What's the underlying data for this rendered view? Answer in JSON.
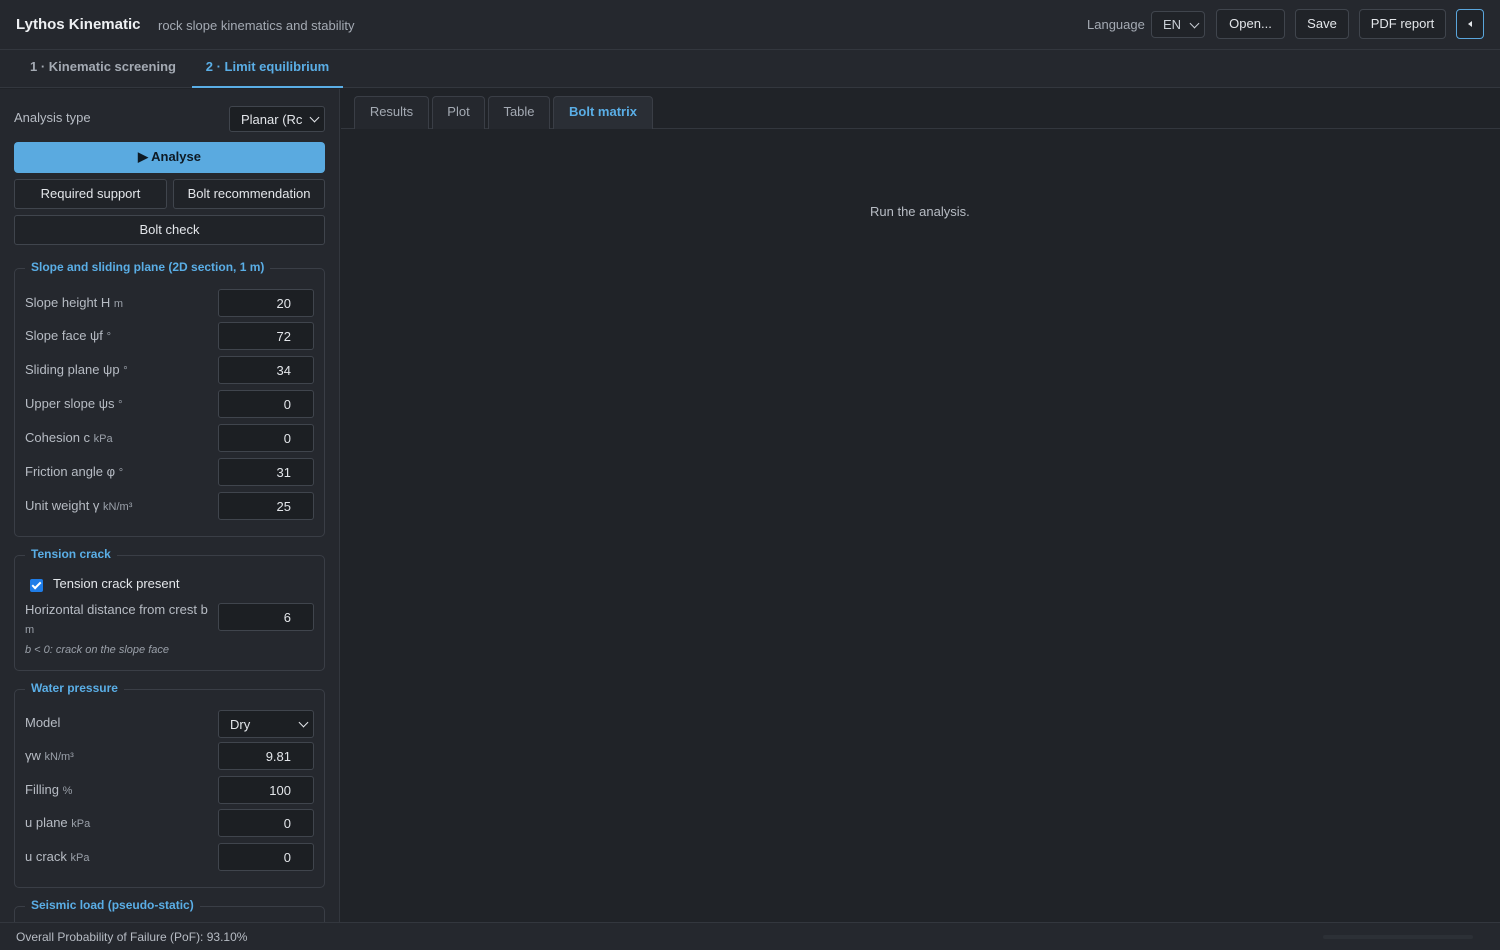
{
  "header": {
    "title": "Lythos Kinematic",
    "subtitle": "rock slope kinematics and stability",
    "language_label": "Language",
    "language_value": "EN",
    "open_label": "Open...",
    "save_label": "Save",
    "pdf_label": "PDF report"
  },
  "main_tabs": [
    {
      "label": "1 · Kinematic screening",
      "active": false
    },
    {
      "label": "2 · Limit equilibrium",
      "active": true
    }
  ],
  "left": {
    "analysis_type_label": "Analysis type",
    "analysis_type_value": "Planar (Rc",
    "analyse_label": "▶ Analyse",
    "required_support_label": "Required support",
    "bolt_recommendation_label": "Bolt recommendation",
    "bolt_check_label": "Bolt check",
    "slope": {
      "legend": "Slope and sliding plane (2D section, 1 m)",
      "rows": [
        {
          "label": "Slope height H",
          "unit": "m",
          "value": "20"
        },
        {
          "label": "Slope face ψf",
          "unit": "°",
          "value": "72"
        },
        {
          "label": "Sliding plane ψp",
          "unit": "°",
          "value": "34"
        },
        {
          "label": "Upper slope ψs",
          "unit": "°",
          "value": "0"
        },
        {
          "label": "Cohesion c",
          "unit": "kPa",
          "value": "0"
        },
        {
          "label": "Friction angle φ",
          "unit": "°",
          "value": "31"
        },
        {
          "label": "Unit weight γ",
          "unit": "kN/m³",
          "value": "25"
        }
      ]
    },
    "crack": {
      "legend": "Tension crack",
      "present_label": "Tension crack present",
      "present_checked": true,
      "distance_label": "Horizontal distance from crest b",
      "distance_unit": "m",
      "distance_value": "6",
      "note": "b < 0: crack on the slope face"
    },
    "water": {
      "legend": "Water pressure",
      "model_label": "Model",
      "model_value": "Dry",
      "rows": [
        {
          "label": "γw",
          "unit": "kN/m³",
          "value": "9.81"
        },
        {
          "label": "Filling",
          "unit": "%",
          "value": "100"
        },
        {
          "label": "u plane",
          "unit": "kPa",
          "value": "0"
        },
        {
          "label": "u crack",
          "unit": "kPa",
          "value": "0"
        }
      ]
    },
    "seismic": {
      "legend": "Seismic load (pseudo-static)"
    }
  },
  "results": {
    "tabs": [
      {
        "label": "Results",
        "active": false
      },
      {
        "label": "Plot",
        "active": false
      },
      {
        "label": "Table",
        "active": false
      },
      {
        "label": "Bolt matrix",
        "active": true
      }
    ],
    "empty_message": "Run the analysis."
  },
  "status": {
    "text": "Overall Probability of Failure (PoF): 93.10%"
  },
  "colors": {
    "accent": "#5aaee6",
    "background": "#202328",
    "panel": "#25282e"
  }
}
